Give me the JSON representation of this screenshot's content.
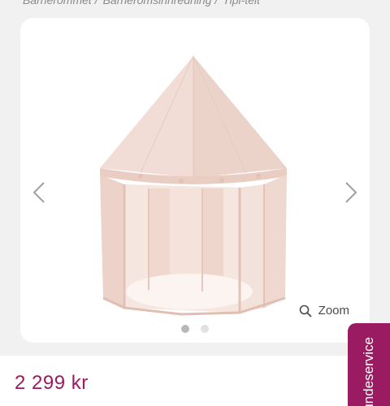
{
  "breadcrumb": {
    "items": [
      "Barnerommet /",
      "Barneromsinnredning /",
      "Tipi-telt"
    ]
  },
  "gallery": {
    "image_alt": "Tipi-telt",
    "prev_icon": "chevron-left-icon",
    "next_icon": "chevron-right-icon",
    "zoom_icon": "magnifier-icon",
    "zoom_label": "Zoom",
    "dots": 2,
    "active_dot": 1
  },
  "product": {
    "price": "2 299 kr"
  },
  "service_tab": {
    "label": "Kundeservice"
  },
  "colors": {
    "accent": "#9b1b63",
    "arrow": "#a0a0a0",
    "background": "#f1f1f1"
  }
}
